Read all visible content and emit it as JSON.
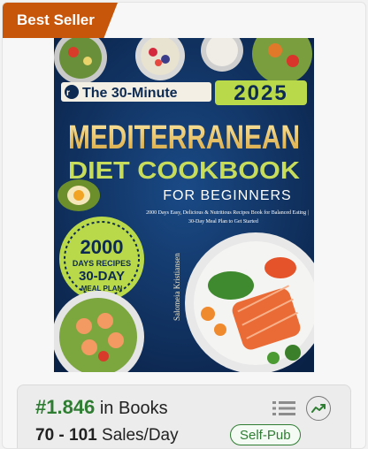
{
  "badge": {
    "label": "Best Seller"
  },
  "book": {
    "series": "The 30-Minute",
    "year": "2025",
    "title_line1": "MEDITERRANEAN",
    "title_line2": "DIET COOKBOOK",
    "title_line3": "FOR BEGINNERS",
    "subtitle_line1": "2000 Days Easy, Delicious & Nutritious Recipes Book for Balanced Eating |",
    "subtitle_line2": "30-Day Meal Plan to Get Started",
    "seal_line1": "2000",
    "seal_line2": "DAYS RECIPES",
    "seal_line3": "30-DAY",
    "seal_line4": "MEAL PLAN",
    "author": "Salomeia Kristiansen"
  },
  "stats": {
    "rank": "#1.846",
    "rank_suffix": "in Books",
    "sales_range": "70 - 101",
    "sales_suffix": "Sales/Day",
    "publisher_badge": "Self-Pub"
  }
}
